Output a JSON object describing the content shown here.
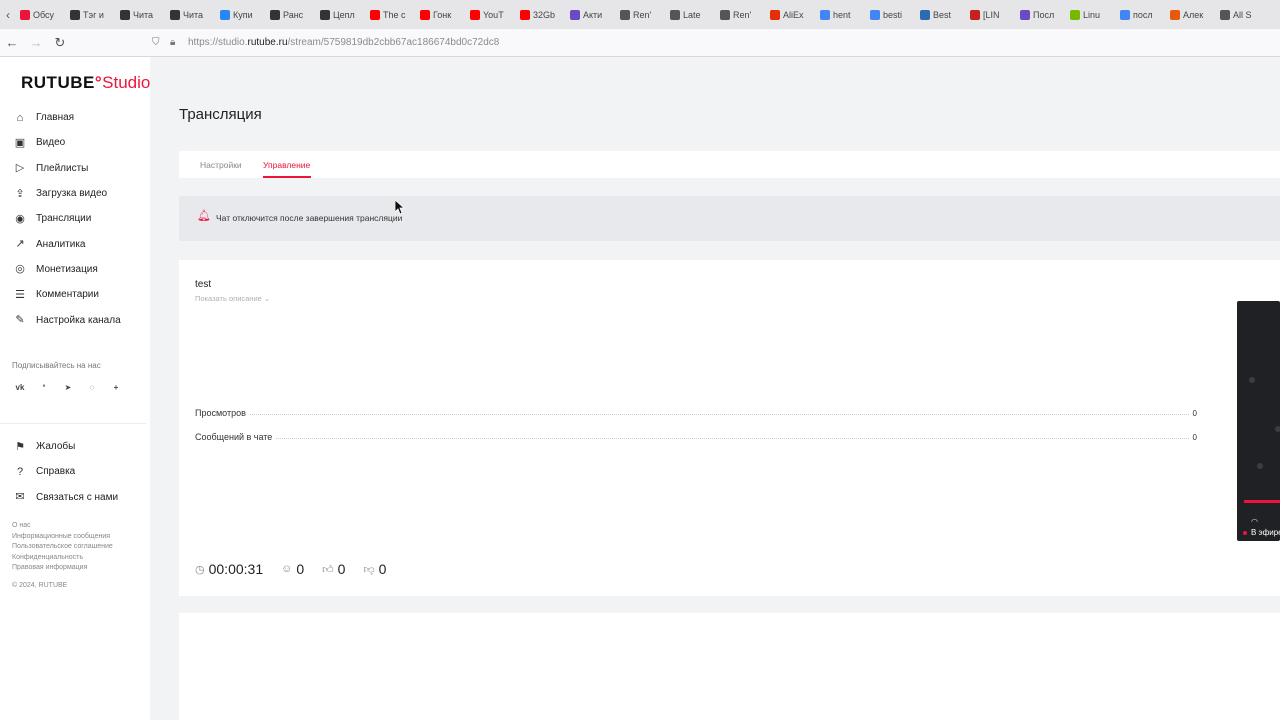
{
  "browser": {
    "bookmarks": [
      {
        "label": "Обсу",
        "color": "#ed143b"
      },
      {
        "label": "Тэг и",
        "color": "#333333"
      },
      {
        "label": "Чита",
        "color": "#333333"
      },
      {
        "label": "Чита",
        "color": "#333333"
      },
      {
        "label": "Купи",
        "color": "#2787f5"
      },
      {
        "label": "Ранс",
        "color": "#333333"
      },
      {
        "label": "Цепл",
        "color": "#333333"
      },
      {
        "label": "The c",
        "color": "#ff0000"
      },
      {
        "label": "Гонк",
        "color": "#ff0000"
      },
      {
        "label": "YouT",
        "color": "#ff0000"
      },
      {
        "label": "32Gb",
        "color": "#ff0000"
      },
      {
        "label": "Акти",
        "color": "#6a4bc4"
      },
      {
        "label": "Ren'",
        "color": "#555555"
      },
      {
        "label": "Late",
        "color": "#555555"
      },
      {
        "label": "Ren'",
        "color": "#555555"
      },
      {
        "label": "AliEx",
        "color": "#e62e04"
      },
      {
        "label": "hent",
        "color": "#4285f4"
      },
      {
        "label": "besti",
        "color": "#4285f4"
      },
      {
        "label": "Best",
        "color": "#2b6cb0"
      },
      {
        "label": "[LIN",
        "color": "#c5221f"
      },
      {
        "label": "Посл",
        "color": "#6a4bc4"
      },
      {
        "label": "Linu",
        "color": "#76b900"
      },
      {
        "label": "посл",
        "color": "#4285f4"
      },
      {
        "label": "Алек",
        "color": "#e8590c"
      },
      {
        "label": "All S",
        "color": "#555555"
      }
    ],
    "url_prefix": "https://studio.",
    "url_host": "rutube.ru",
    "url_path": "/stream/5759819db2cbb67ac186674bd0c72dc8"
  },
  "sidebar": {
    "logo_main": "RUTUBE",
    "logo_studio": "Studio",
    "items": [
      {
        "label": "Главная",
        "icon": "home-icon",
        "glyph": "⌂"
      },
      {
        "label": "Видео",
        "icon": "video-icon",
        "glyph": "▣"
      },
      {
        "label": "Плейлисты",
        "icon": "playlist-icon",
        "glyph": "▷"
      },
      {
        "label": "Загрузка видео",
        "icon": "upload-icon",
        "glyph": "⇪"
      },
      {
        "label": "Трансляции",
        "icon": "broadcast-icon",
        "glyph": "◉"
      },
      {
        "label": "Аналитика",
        "icon": "analytics-icon",
        "glyph": "↗"
      },
      {
        "label": "Монетизация",
        "icon": "monetization-icon",
        "glyph": "◎"
      },
      {
        "label": "Комментарии",
        "icon": "comments-icon",
        "glyph": "☰"
      },
      {
        "label": "Настройка канала",
        "icon": "wand-icon",
        "glyph": "✎"
      }
    ],
    "follow_label": "Подписывайтесь на нас",
    "social": [
      {
        "label": "vk",
        "icon": "vk-icon",
        "glyph": "vk"
      },
      {
        "label": "ok",
        "icon": "odnoklassniki-icon",
        "glyph": "ᐤ"
      },
      {
        "label": "tg",
        "icon": "telegram-icon",
        "glyph": "➤"
      },
      {
        "label": "viber",
        "icon": "viber-icon",
        "glyph": "◌"
      },
      {
        "label": "more",
        "icon": "plus-icon",
        "glyph": "+"
      }
    ],
    "items2": [
      {
        "label": "Жалобы",
        "icon": "complaints-icon",
        "glyph": "⚑"
      },
      {
        "label": "Справка",
        "icon": "help-icon",
        "glyph": "?"
      },
      {
        "label": "Связаться с нами",
        "icon": "contact-icon",
        "glyph": "✉"
      }
    ],
    "footer_links": [
      "О нас",
      "Информационные сообщения",
      "Пользовательское соглашение",
      "Конфиденциальность",
      "Правовая информация"
    ],
    "copyright": "© 2024, RUTUBE"
  },
  "main": {
    "title": "Трансляция",
    "tabs": [
      {
        "label": "Настройки",
        "active": false
      },
      {
        "label": "Управление",
        "active": true
      }
    ],
    "alert_text": "Чат отключится после завершения трансляции",
    "stream_name": "test",
    "show_description": "Показать описание",
    "stats": [
      {
        "label": "Просмотров",
        "value": "0"
      },
      {
        "label": "Сообщений в чате",
        "value": "0"
      }
    ],
    "duration": "00:00:31",
    "viewers": "0",
    "likes": "0",
    "dislikes": "0",
    "player_live": "В эфире"
  },
  "colors": {
    "accent": "#ed143b"
  }
}
